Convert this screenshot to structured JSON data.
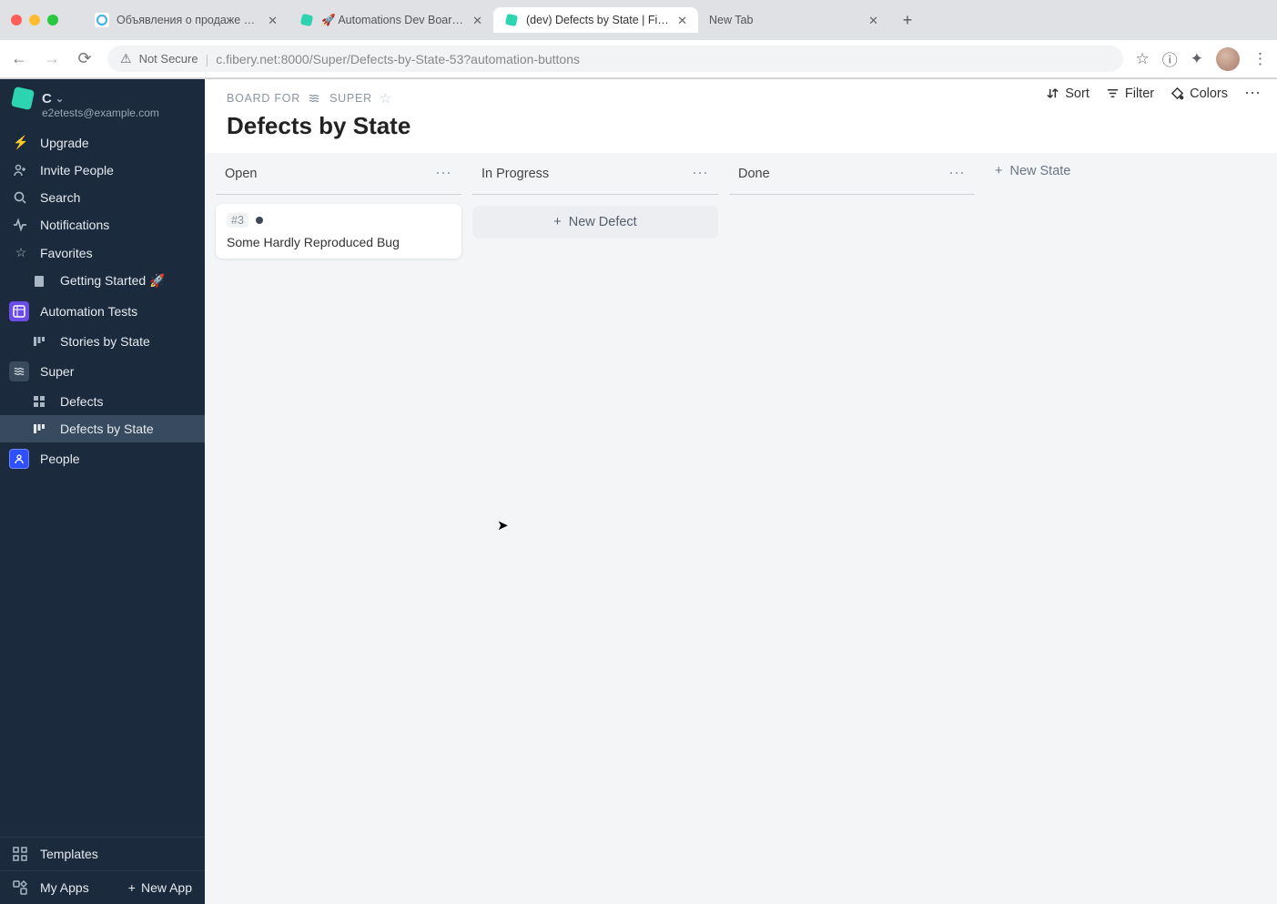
{
  "browser": {
    "tabs": [
      {
        "title": "Объявления о продаже автом",
        "icon_color": "#4ab4e6"
      },
      {
        "title": "🚀 Automations Dev Board | Fi",
        "icon_color": "#2cd4b0"
      },
      {
        "title": "(dev) Defects by State | Fibery",
        "icon_color": "#2cd4b0",
        "active": true
      },
      {
        "title": "New Tab",
        "icon_color": "transparent"
      }
    ],
    "not_secure": "Not Secure",
    "url_host": "c.fibery.net",
    "url_port": ":8000",
    "url_path": "/Super/Defects-by-State-53?automation-buttons"
  },
  "workspace": {
    "letter": "C",
    "email": "e2etests@example.com"
  },
  "sidebar": {
    "upgrade": "Upgrade",
    "invite": "Invite People",
    "search": "Search",
    "notifications": "Notifications",
    "favorites": "Favorites",
    "getting_started": "Getting Started 🚀",
    "automation_tests": "Automation Tests",
    "stories_by_state": "Stories by State",
    "super": "Super",
    "defects": "Defects",
    "defects_by_state": "Defects by State",
    "people": "People",
    "templates": "Templates",
    "my_apps": "My Apps",
    "new_app": "New App"
  },
  "header": {
    "board_for": "BOARD FOR",
    "space": "SUPER",
    "title": "Defects by State",
    "sort": "Sort",
    "filter": "Filter",
    "colors": "Colors"
  },
  "board": {
    "columns": [
      {
        "name": "Open"
      },
      {
        "name": "In Progress"
      },
      {
        "name": "Done"
      }
    ],
    "new_state": "New State",
    "cards": {
      "open": [
        {
          "id": "#3",
          "title": "Some Hardly Reproduced Bug"
        }
      ]
    },
    "new_defect": "New Defect"
  }
}
